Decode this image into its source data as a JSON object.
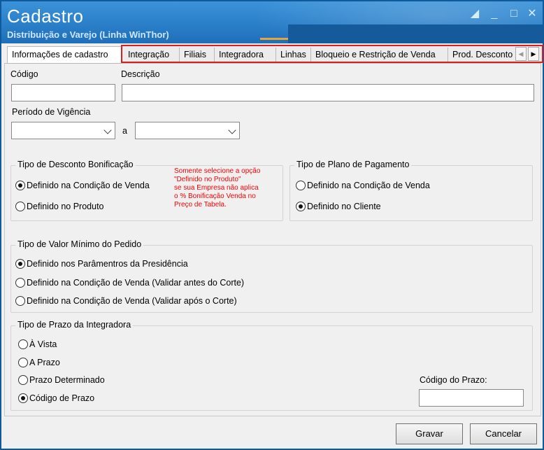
{
  "window": {
    "title": "Cadastro",
    "subtitle": "Distribuição e Varejo (Linha WinThor)"
  },
  "tabs": {
    "active": "Informações de cadastro",
    "items": [
      "Integração",
      "Filiais",
      "Integradora",
      "Linhas",
      "Bloqueio e Restrição de Venda",
      "Prod. Desconto"
    ]
  },
  "form": {
    "codigo_label": "Código",
    "codigo_value": "",
    "descricao_label": "Descrição",
    "descricao_value": "",
    "periodo_label": "Período de Vigência",
    "periodo_sep": "a",
    "periodo_inicio": "",
    "periodo_fim": ""
  },
  "desconto": {
    "title": "Tipo de Desconto Bonificação",
    "opt1": "Definido na Condição de Venda",
    "opt2": "Definido no Produto",
    "note1": "Somente selecione a opção",
    "note2": "\"Definido no Produto\"",
    "note3": "se sua Empresa não aplica",
    "note4": "o % Bonificação Venda no",
    "note5": "Preço de Tabela."
  },
  "plano": {
    "title": "Tipo de Plano de Pagamento",
    "opt1": "Definido na Condição de Venda",
    "opt2": "Definido no Cliente"
  },
  "valor_minimo": {
    "title": "Tipo de Valor Mínimo do Pedido",
    "opt1": "Definido nos Parâmentros da Presidência",
    "opt2": "Definido na Condição  de Venda (Validar antes do Corte)",
    "opt3": "Definido na Condição de Venda (Validar após o Corte)"
  },
  "prazo": {
    "title": "Tipo de Prazo da Integradora",
    "opt1": "À Vista",
    "opt2": "A Prazo",
    "opt3": "Prazo Determinado",
    "opt4": "Código de Prazo",
    "codigo_label": "Código do Prazo:",
    "codigo_value": ""
  },
  "buttons": {
    "gravar": "Gravar",
    "cancelar": "Cancelar"
  },
  "colors": {
    "titlebar": "#2a7fc9",
    "tab_highlight": "#d81e1e",
    "note_text": "#ff0000"
  }
}
